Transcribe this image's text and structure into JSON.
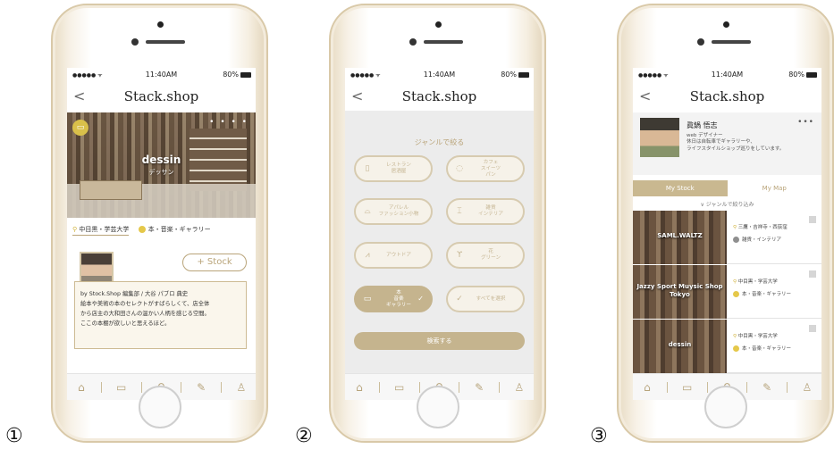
{
  "figure_numbers": [
    "①",
    "②",
    "③"
  ],
  "status_bar": {
    "signal": "●●●●● ᯤ",
    "time": "11:40AM",
    "battery": "80%"
  },
  "app": {
    "logo": "Stack.shop",
    "back": "<"
  },
  "screen1": {
    "shop_name": "dessin",
    "shop_kana": "デッサン",
    "hero_dots": "• • • •",
    "location": "中目黒・学芸大学",
    "category": "本・音楽・ギャラリー",
    "stock_button": "+ Stock",
    "comment_author": "by Stock.Shop 編集部 / 大谷 パブロ 典史",
    "comment_lines": [
      "絵本や美術の本のセレクトがすばらしくて、店全体",
      "から店主の大和田さんの温かい人柄を感じる空間。",
      "ここの本棚が欲しいと思えるほど。"
    ]
  },
  "screen2": {
    "title": "ジャンルで絞る",
    "genres": [
      {
        "label": "レストラン\n居酒屋",
        "icon": "▯"
      },
      {
        "label": "カフェ\nスイーツ\nパン",
        "icon": "◌"
      },
      {
        "label": "アパレル\nファッション小物",
        "icon": "⌓"
      },
      {
        "label": "雑貨\nインテリア",
        "icon": "⌶"
      },
      {
        "label": "アウトドア",
        "icon": "⩘"
      },
      {
        "label": "花\nグリーン",
        "icon": "ϒ"
      },
      {
        "label": "本\n音楽\nギャラリー",
        "icon": "▭",
        "check": "✓"
      },
      {
        "label": "すべてを選択",
        "icon": "✓"
      }
    ],
    "search_button": "検索する"
  },
  "screen3": {
    "user_name": "眞鍋 悟志",
    "user_role": "web デザイナー",
    "user_bio_1": "休日は自転車でギャラリーや、",
    "user_bio_2": "ライフスタイルショップ巡りをしています。",
    "more": "•••",
    "tab_stock": "My Stock",
    "tab_map": "My Map",
    "filter": "∨  ジャンルで絞り込み",
    "shops": [
      {
        "name": "SAML.WALTZ",
        "location": "三鷹・吉祥寺・西荻窪",
        "category": "雑貨・インテリア",
        "cat_color": "#8f8f8f"
      },
      {
        "name": "Jazzy Sport Muysic Shop\nTokyo",
        "location": "中目黒・学芸大学",
        "category": "本・音楽・ギャラリー",
        "cat_color": "#e5c84a"
      },
      {
        "name": "dessin",
        "location": "中目黒・学芸大学",
        "category": "本・音楽・ギャラリー",
        "cat_color": "#e5c84a"
      }
    ]
  },
  "tab_icons": [
    "⌂",
    "▭",
    "⚲",
    "✎",
    "♙"
  ],
  "colors": {
    "accent": "#b9a479",
    "selected_fill": "#c5b48e",
    "marker": "#e5c84a"
  }
}
